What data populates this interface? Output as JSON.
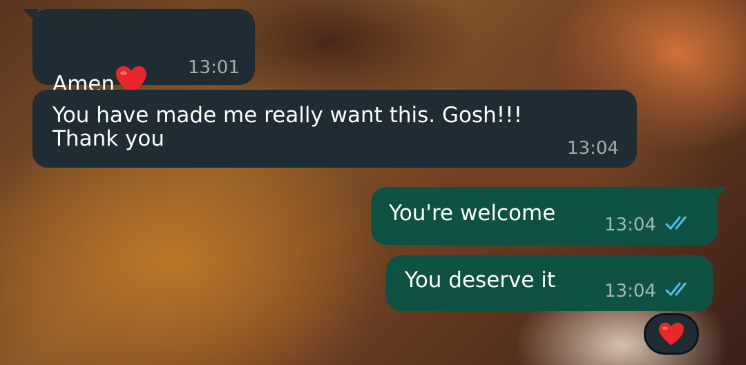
{
  "messages": [
    {
      "direction": "incoming",
      "text": "Amen",
      "emoji": "red-heart",
      "time": "13:01"
    },
    {
      "direction": "incoming",
      "text": "You have made me really want this. Gosh!!!\nThank you",
      "time": "13:04"
    },
    {
      "direction": "outgoing",
      "text": "You're welcome",
      "time": "13:04",
      "status": "read"
    },
    {
      "direction": "outgoing",
      "text": "You deserve it",
      "time": "13:04",
      "status": "read",
      "reaction": "red-heart"
    }
  ],
  "colors": {
    "incoming_bubble": "#1f2c33",
    "outgoing_bubble": "#0f5142",
    "read_ticks": "#53bdeb",
    "heart": "#e8262b"
  }
}
